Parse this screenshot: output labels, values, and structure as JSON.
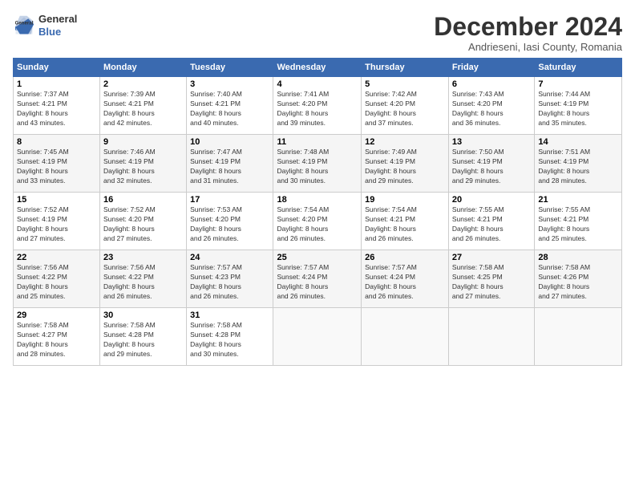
{
  "logo": {
    "line1": "General",
    "line2": "Blue"
  },
  "title": "December 2024",
  "subtitle": "Andrieseni, Iasi County, Romania",
  "weekdays": [
    "Sunday",
    "Monday",
    "Tuesday",
    "Wednesday",
    "Thursday",
    "Friday",
    "Saturday"
  ],
  "weeks": [
    [
      {
        "day": "1",
        "info": "Sunrise: 7:37 AM\nSunset: 4:21 PM\nDaylight: 8 hours\nand 43 minutes."
      },
      {
        "day": "2",
        "info": "Sunrise: 7:39 AM\nSunset: 4:21 PM\nDaylight: 8 hours\nand 42 minutes."
      },
      {
        "day": "3",
        "info": "Sunrise: 7:40 AM\nSunset: 4:21 PM\nDaylight: 8 hours\nand 40 minutes."
      },
      {
        "day": "4",
        "info": "Sunrise: 7:41 AM\nSunset: 4:20 PM\nDaylight: 8 hours\nand 39 minutes."
      },
      {
        "day": "5",
        "info": "Sunrise: 7:42 AM\nSunset: 4:20 PM\nDaylight: 8 hours\nand 37 minutes."
      },
      {
        "day": "6",
        "info": "Sunrise: 7:43 AM\nSunset: 4:20 PM\nDaylight: 8 hours\nand 36 minutes."
      },
      {
        "day": "7",
        "info": "Sunrise: 7:44 AM\nSunset: 4:19 PM\nDaylight: 8 hours\nand 35 minutes."
      }
    ],
    [
      {
        "day": "8",
        "info": "Sunrise: 7:45 AM\nSunset: 4:19 PM\nDaylight: 8 hours\nand 33 minutes."
      },
      {
        "day": "9",
        "info": "Sunrise: 7:46 AM\nSunset: 4:19 PM\nDaylight: 8 hours\nand 32 minutes."
      },
      {
        "day": "10",
        "info": "Sunrise: 7:47 AM\nSunset: 4:19 PM\nDaylight: 8 hours\nand 31 minutes."
      },
      {
        "day": "11",
        "info": "Sunrise: 7:48 AM\nSunset: 4:19 PM\nDaylight: 8 hours\nand 30 minutes."
      },
      {
        "day": "12",
        "info": "Sunrise: 7:49 AM\nSunset: 4:19 PM\nDaylight: 8 hours\nand 29 minutes."
      },
      {
        "day": "13",
        "info": "Sunrise: 7:50 AM\nSunset: 4:19 PM\nDaylight: 8 hours\nand 29 minutes."
      },
      {
        "day": "14",
        "info": "Sunrise: 7:51 AM\nSunset: 4:19 PM\nDaylight: 8 hours\nand 28 minutes."
      }
    ],
    [
      {
        "day": "15",
        "info": "Sunrise: 7:52 AM\nSunset: 4:19 PM\nDaylight: 8 hours\nand 27 minutes."
      },
      {
        "day": "16",
        "info": "Sunrise: 7:52 AM\nSunset: 4:20 PM\nDaylight: 8 hours\nand 27 minutes."
      },
      {
        "day": "17",
        "info": "Sunrise: 7:53 AM\nSunset: 4:20 PM\nDaylight: 8 hours\nand 26 minutes."
      },
      {
        "day": "18",
        "info": "Sunrise: 7:54 AM\nSunset: 4:20 PM\nDaylight: 8 hours\nand 26 minutes."
      },
      {
        "day": "19",
        "info": "Sunrise: 7:54 AM\nSunset: 4:21 PM\nDaylight: 8 hours\nand 26 minutes."
      },
      {
        "day": "20",
        "info": "Sunrise: 7:55 AM\nSunset: 4:21 PM\nDaylight: 8 hours\nand 26 minutes."
      },
      {
        "day": "21",
        "info": "Sunrise: 7:55 AM\nSunset: 4:21 PM\nDaylight: 8 hours\nand 25 minutes."
      }
    ],
    [
      {
        "day": "22",
        "info": "Sunrise: 7:56 AM\nSunset: 4:22 PM\nDaylight: 8 hours\nand 25 minutes."
      },
      {
        "day": "23",
        "info": "Sunrise: 7:56 AM\nSunset: 4:22 PM\nDaylight: 8 hours\nand 26 minutes."
      },
      {
        "day": "24",
        "info": "Sunrise: 7:57 AM\nSunset: 4:23 PM\nDaylight: 8 hours\nand 26 minutes."
      },
      {
        "day": "25",
        "info": "Sunrise: 7:57 AM\nSunset: 4:24 PM\nDaylight: 8 hours\nand 26 minutes."
      },
      {
        "day": "26",
        "info": "Sunrise: 7:57 AM\nSunset: 4:24 PM\nDaylight: 8 hours\nand 26 minutes."
      },
      {
        "day": "27",
        "info": "Sunrise: 7:58 AM\nSunset: 4:25 PM\nDaylight: 8 hours\nand 27 minutes."
      },
      {
        "day": "28",
        "info": "Sunrise: 7:58 AM\nSunset: 4:26 PM\nDaylight: 8 hours\nand 27 minutes."
      }
    ],
    [
      {
        "day": "29",
        "info": "Sunrise: 7:58 AM\nSunset: 4:27 PM\nDaylight: 8 hours\nand 28 minutes."
      },
      {
        "day": "30",
        "info": "Sunrise: 7:58 AM\nSunset: 4:28 PM\nDaylight: 8 hours\nand 29 minutes."
      },
      {
        "day": "31",
        "info": "Sunrise: 7:58 AM\nSunset: 4:28 PM\nDaylight: 8 hours\nand 30 minutes."
      },
      null,
      null,
      null,
      null
    ]
  ]
}
